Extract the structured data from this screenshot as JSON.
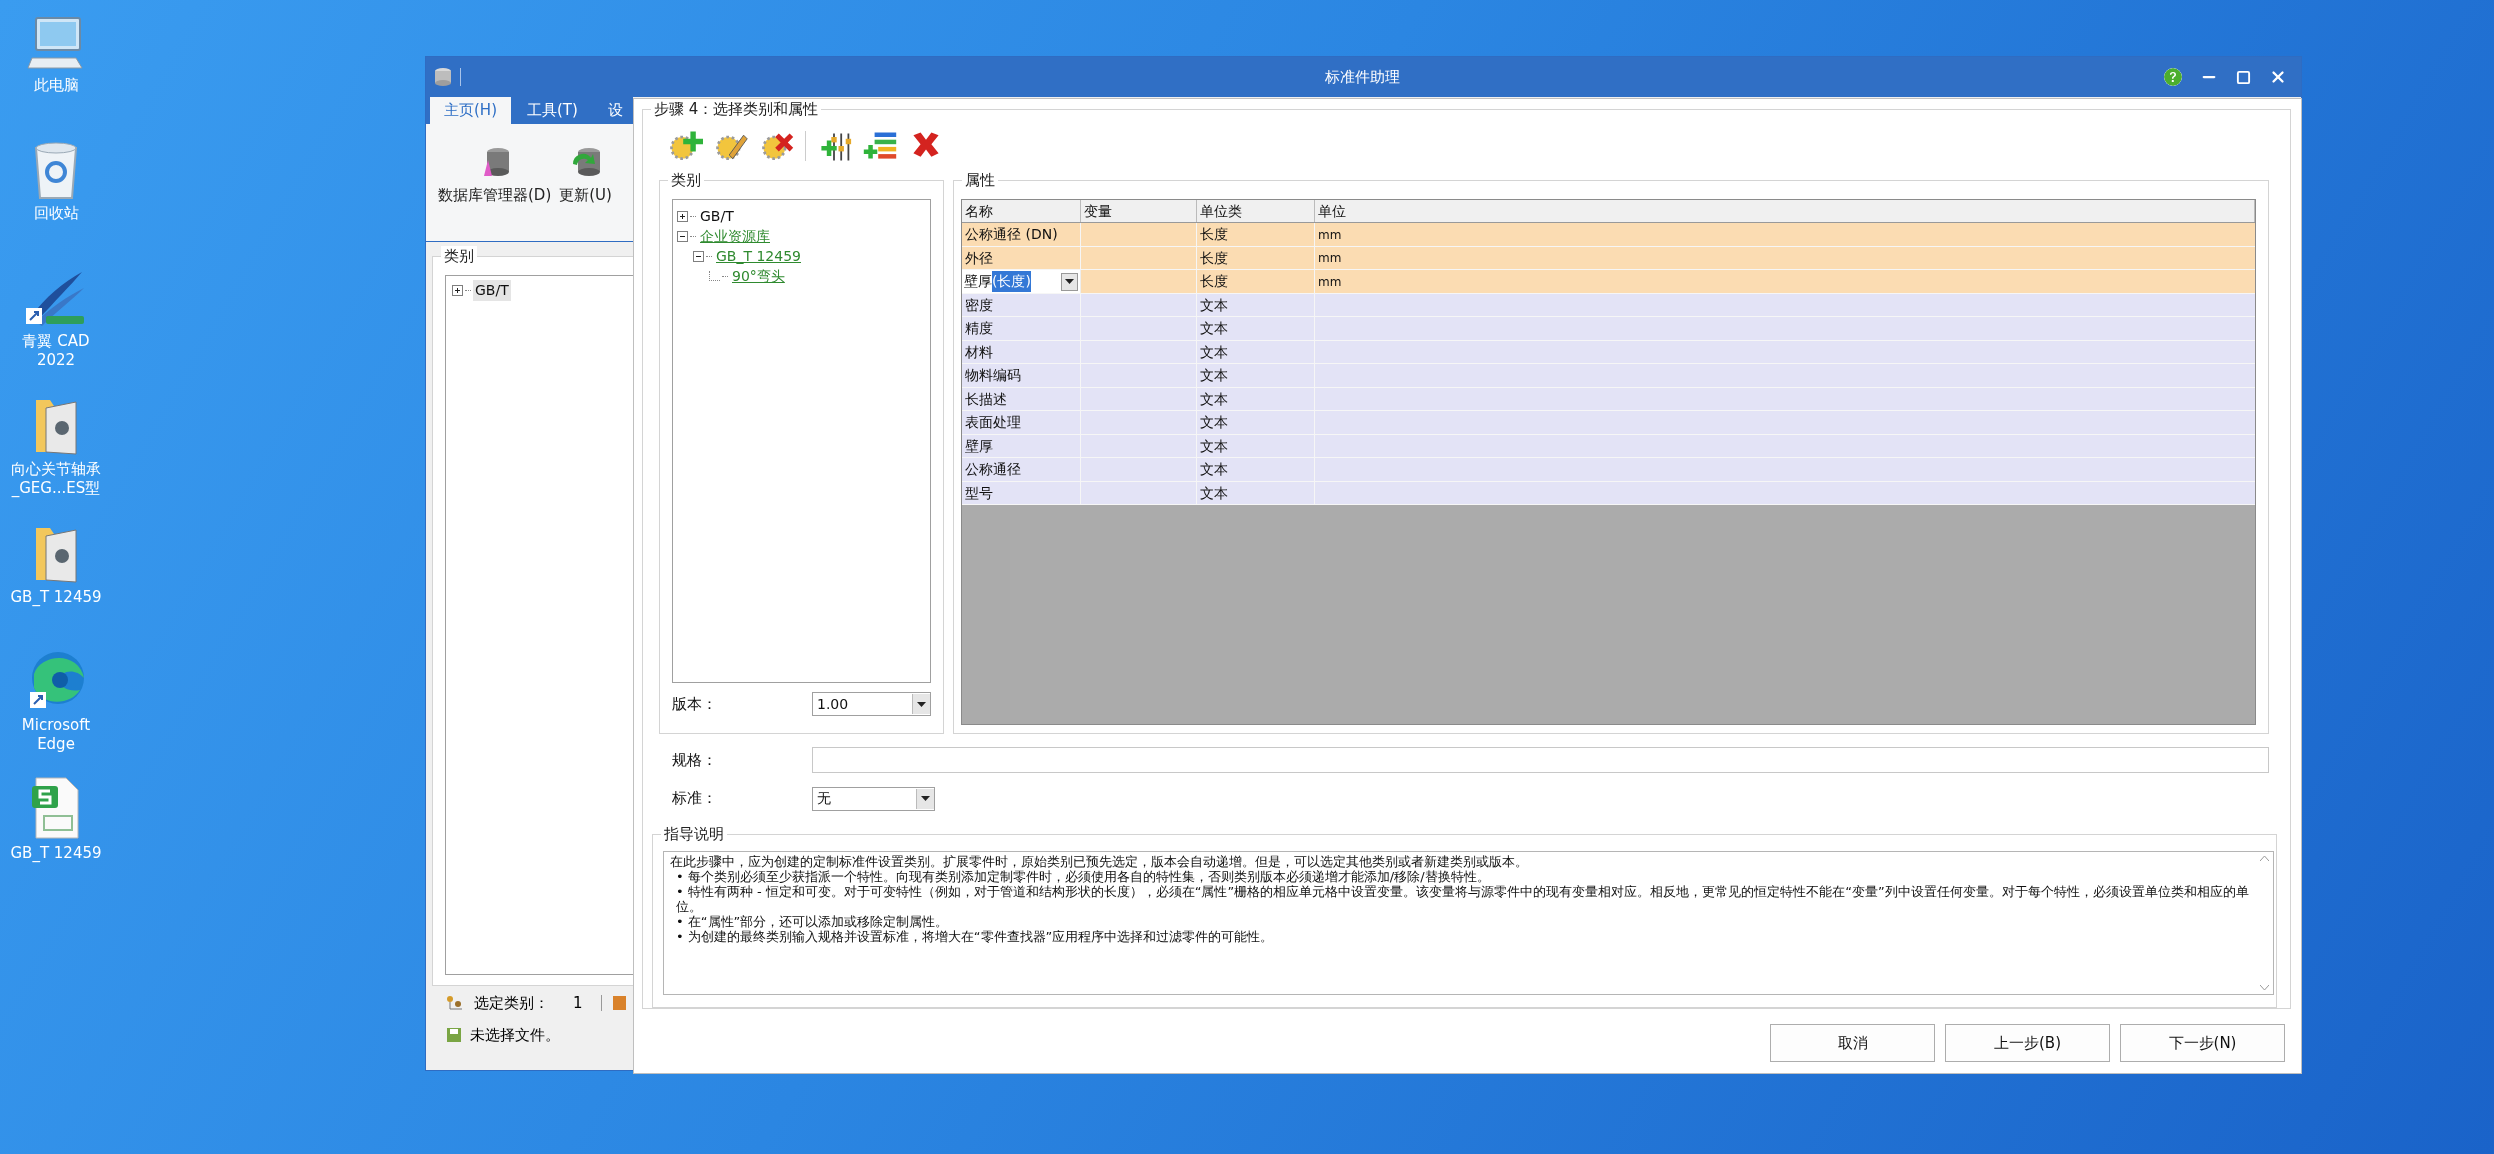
{
  "desktop_icons": [
    {
      "label": "此电脑",
      "kind": "computer"
    },
    {
      "label": "回收站",
      "kind": "recycle"
    },
    {
      "label": "青翼 CAD 2022",
      "kind": "cad"
    },
    {
      "label": "向心关节轴承_GEG...ES型",
      "kind": "folder"
    },
    {
      "label": "GB_T 12459",
      "kind": "folder"
    },
    {
      "label": "Microsoft Edge",
      "kind": "edge"
    },
    {
      "label": "GB_T 12459",
      "kind": "sheet"
    }
  ],
  "main_window": {
    "title": "标准件助理",
    "tabs": [
      {
        "label": "主页(H)",
        "selected": true
      },
      {
        "label": "工具(T)",
        "selected": false
      },
      {
        "label": "设",
        "selected": false
      }
    ],
    "ribbon": [
      {
        "label": "数据库管理器(D)",
        "kind": "database"
      },
      {
        "label": "更新(U)",
        "kind": "update"
      }
    ],
    "category_panel": {
      "title": "类别",
      "tree": [
        {
          "label": "GB/T",
          "expanded": false,
          "selected": true
        }
      ]
    },
    "status": {
      "selected_label": "选定类别：",
      "selected_count": "1",
      "file": "未选择文件。"
    }
  },
  "dialog": {
    "step_title": "步骤 4：选择类别和属性",
    "category": {
      "title": "类别",
      "tree": [
        {
          "label": "GB/T",
          "expanded": false,
          "selected": false
        },
        {
          "label": "企业资源库",
          "expanded": true,
          "selected": false,
          "kind": "link",
          "children": [
            {
              "label": "GB_T 12459",
              "expanded": true,
              "selected": false,
              "kind": "link",
              "children": [
                {
                  "label": "90°弯头",
                  "selected": false,
                  "kind": "link"
                }
              ]
            }
          ]
        }
      ],
      "version_label": "版本：",
      "version": "1.00"
    },
    "properties": {
      "title": "属性",
      "columns": [
        "名称",
        "变量",
        "单位类",
        "单位"
      ],
      "rows": [
        {
          "name": "公称通径 (DN)",
          "unit_class": "长度",
          "unit": "mm",
          "selected": true,
          "editing": false
        },
        {
          "name": "外径",
          "unit_class": "长度",
          "unit": "mm",
          "selected": true,
          "editing": false
        },
        {
          "name": "壁厚",
          "editor_value": "(长度)",
          "unit_class": "长度",
          "unit": "mm",
          "selected": true,
          "editing": true
        },
        {
          "name": "密度",
          "unit_class": "文本",
          "selected": false,
          "editing": false
        },
        {
          "name": "精度",
          "unit_class": "文本",
          "selected": false,
          "editing": false
        },
        {
          "name": "材料",
          "unit_class": "文本",
          "selected": false,
          "editing": false
        },
        {
          "name": "物料编码",
          "unit_class": "文本",
          "selected": false,
          "editing": false
        },
        {
          "name": "长描述",
          "unit_class": "文本",
          "selected": false,
          "editing": false
        },
        {
          "name": "表面处理",
          "unit_class": "文本",
          "selected": false,
          "editing": false
        },
        {
          "name": "壁厚",
          "unit_class": "文本",
          "selected": false,
          "editing": false
        },
        {
          "name": "公称通径",
          "unit_class": "文本",
          "selected": false,
          "editing": false
        },
        {
          "name": "型号",
          "unit_class": "文本",
          "selected": false,
          "editing": false
        }
      ]
    },
    "spec": {
      "label": "规格："
    },
    "standard": {
      "label": "标准：",
      "value": "无"
    },
    "guidance": {
      "title": "指导说明",
      "intro": "在此步骤中，应为创建的定制标准件设置类别。扩展零件时，原始类别已预先选定，版本会自动递增。但是，可以选定其他类别或者新建类别或版本。",
      "bullets": [
        "• 每个类别必须至少获指派一个特性。向现有类别添加定制零件时，必须使用各自的特性集，否则类别版本必须递增才能添加/移除/替换特性。",
        "• 特性有两种 - 恒定和可变。对于可变特性（例如，对于管道和结构形状的长度），必须在“属性”栅格的相应单元格中设置变量。该变量将与源零件中的现有变量相对应。相反地，更常见的恒定特性不能在“变量”列中设置任何变量。对于每个特性，必须设置单位类和相应的单位。",
        "• 在“属性”部分，还可以添加或移除定制属性。",
        "• 为创建的最终类别输入规格并设置标准，将增大在“零件查找器”应用程序中选择和过滤零件的可能性。"
      ]
    },
    "buttons": [
      {
        "label": "取消"
      },
      {
        "label": "上一步(B)"
      },
      {
        "label": "下一步(N)"
      }
    ]
  }
}
